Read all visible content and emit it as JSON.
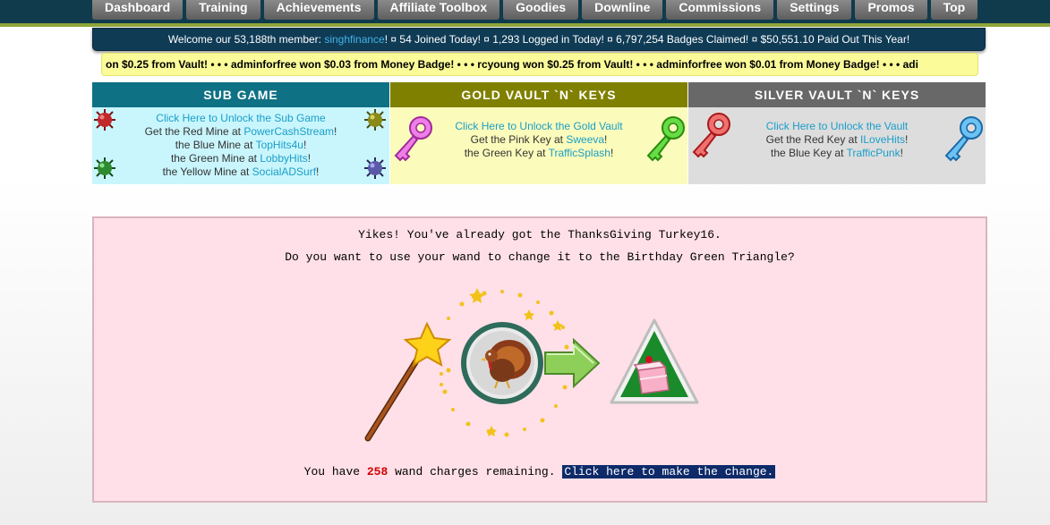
{
  "nav": {
    "items": [
      "Dashboard",
      "Training",
      "Achievements",
      "Affiliate Toolbox",
      "Goodies",
      "Downline",
      "Commissions",
      "Settings",
      "Promos",
      "Top"
    ]
  },
  "welcome": {
    "prefix": "Welcome our 53,188th member: ",
    "member": "singhfinance",
    "suffix": "! ¤   54 Joined Today! ¤   1,293 Logged in Today! ¤   6,797,254 Badges Claimed! ¤   $50,551.10 Paid Out This Year!"
  },
  "ticker": {
    "text": "on $0.25 from Vault! • • • adminforfree won $0.03 from Money Badge! • • • rcyoung won $0.25 from Vault! • • • adminforfree won $0.01 from Money Badge! • • • adi"
  },
  "sub_game": {
    "title": "SUB GAME",
    "unlock": "Click Here to Unlock the Sub Game",
    "lines": [
      {
        "pre": "Get the Red Mine at ",
        "site": "PowerCashStream",
        "post": "!"
      },
      {
        "pre": "the Blue Mine at ",
        "site": "TopHits4u",
        "post": "!"
      },
      {
        "pre": "the Green Mine at ",
        "site": "LobbyHits",
        "post": "!"
      },
      {
        "pre": "the Yellow Mine at ",
        "site": "SocialADSurf",
        "post": "!"
      }
    ]
  },
  "gold_vault": {
    "title": "GOLD VAULT `N` KEYS",
    "unlock": "Click Here to Unlock the Gold Vault",
    "lines": [
      {
        "pre": "Get the Pink Key at ",
        "site": "Sweeva",
        "post": "!"
      },
      {
        "pre": "the Green Key at ",
        "site": "TrafficSplash",
        "post": "!"
      }
    ]
  },
  "silver_vault": {
    "title": "SILVER VAULT `N` KEYS",
    "unlock": "Click Here to Unlock the Vault",
    "lines": [
      {
        "pre": "Get the Red Key at ",
        "site": "ILoveHits",
        "post": "!"
      },
      {
        "pre": "the Blue Key at ",
        "site": "TrafficPunk",
        "post": "!"
      }
    ]
  },
  "panel": {
    "line1": "Yikes! You've already got the ThanksGiving Turkey16.",
    "line2": "Do you want to use your wand to change it to the Birthday Green Triangle?",
    "charges_pre": "You have ",
    "charges": "258",
    "charges_post": " wand charges remaining. ",
    "change_link": "Click here to make the change."
  },
  "colors": {
    "topbar": "#0f3b4c",
    "sub_head": "#0f7184",
    "gold_head": "#808000",
    "silver_head": "#686868",
    "panel_bg": "#ffe0e8",
    "link": "#1a9ec9",
    "charges": "#d10000"
  }
}
